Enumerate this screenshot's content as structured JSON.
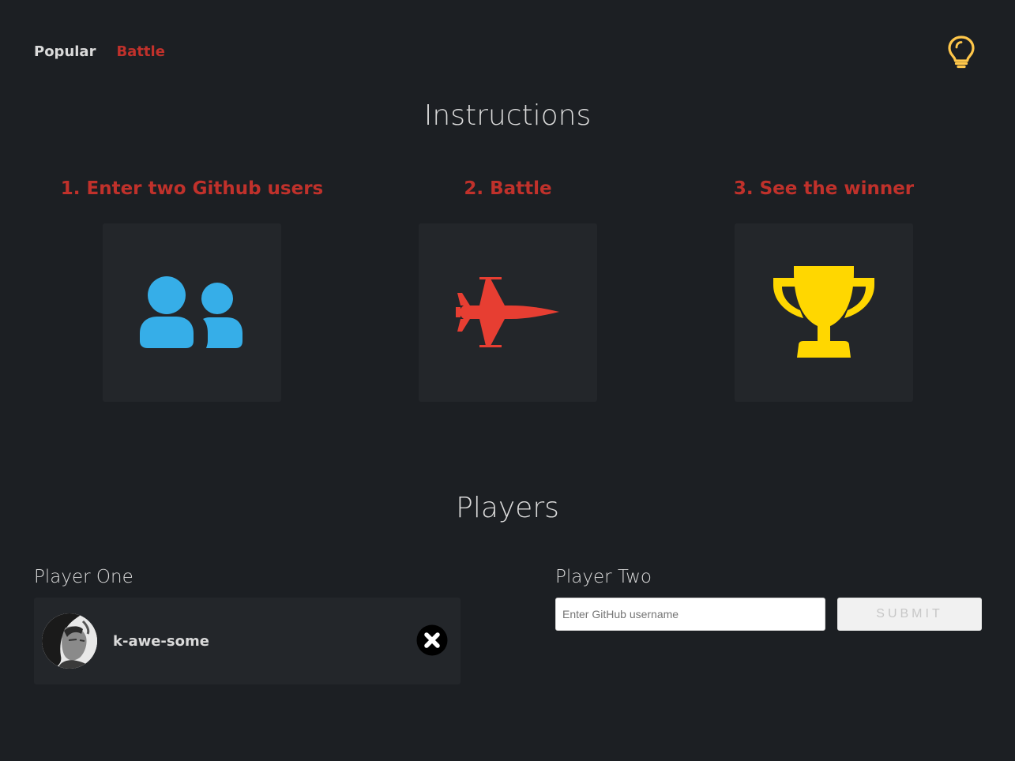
{
  "nav": {
    "popular_label": "Popular",
    "battle_label": "Battle",
    "theme_icon": "lightbulb-icon"
  },
  "instructions": {
    "title": "Instructions",
    "steps": [
      {
        "title": "1. Enter two Github users",
        "icon": "users-icon",
        "color": "#36aee8"
      },
      {
        "title": "2. Battle",
        "icon": "fighter-jet-icon",
        "color": "#e73e32"
      },
      {
        "title": "3. See the winner",
        "icon": "trophy-icon",
        "color": "#ffd700"
      }
    ]
  },
  "players": {
    "title": "Players",
    "player_one": {
      "label": "Player One",
      "username": "k-awe-some",
      "remove_icon": "close-circle-icon"
    },
    "player_two": {
      "label": "Player Two",
      "input_placeholder": "Enter GitHub username",
      "input_value": "",
      "submit_label": "SUBMIT"
    }
  },
  "colors": {
    "background": "#1c1f23",
    "card": "#23262a",
    "accent": "#c0312b",
    "text": "#dadada",
    "lightbulb": "#ffc74a"
  }
}
